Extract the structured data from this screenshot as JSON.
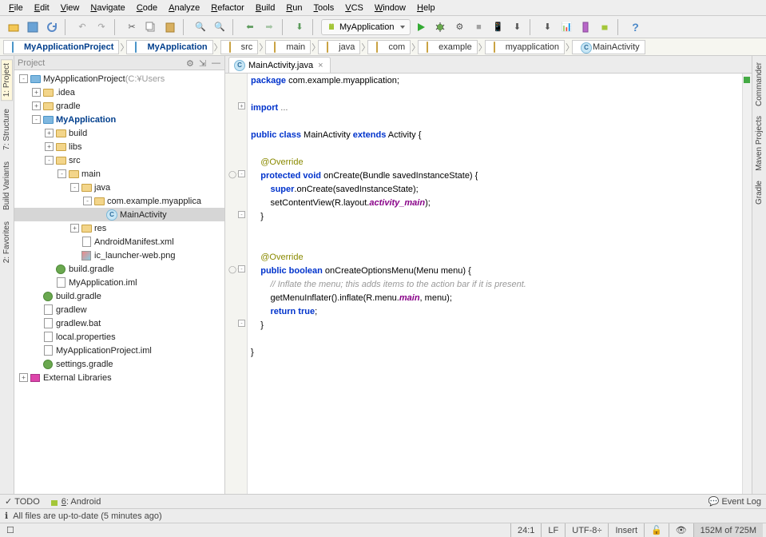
{
  "menu": [
    "File",
    "Edit",
    "View",
    "Navigate",
    "Code",
    "Analyze",
    "Refactor",
    "Build",
    "Run",
    "Tools",
    "VCS",
    "Window",
    "Help"
  ],
  "run_config": {
    "label": "MyApplication"
  },
  "breadcrumb": {
    "items": [
      {
        "label": "MyApplicationProject",
        "icon": "folder-blue",
        "bold": true
      },
      {
        "label": "MyApplication",
        "icon": "folder-blue",
        "bold": true
      },
      {
        "label": "src",
        "icon": "folder",
        "bold": false
      },
      {
        "label": "main",
        "icon": "folder",
        "bold": false
      },
      {
        "label": "java",
        "icon": "folder",
        "bold": false
      },
      {
        "label": "com",
        "icon": "folder",
        "bold": false
      },
      {
        "label": "example",
        "icon": "folder",
        "bold": false
      },
      {
        "label": "myapplication",
        "icon": "folder",
        "bold": false
      },
      {
        "label": "MainActivity",
        "icon": "class",
        "bold": false
      }
    ]
  },
  "sidebars": {
    "left": [
      {
        "label": "1: Project",
        "icon": "project"
      },
      {
        "label": "7: Structure",
        "icon": "structure"
      },
      {
        "label": "Build Variants",
        "icon": "build"
      },
      {
        "label": "2: Favorites",
        "icon": "fav"
      }
    ],
    "right": [
      {
        "label": "Commander",
        "icon": "commander"
      },
      {
        "label": "Maven Projects",
        "icon": "maven"
      },
      {
        "label": "Gradle",
        "icon": "gradle"
      }
    ]
  },
  "project_panel": {
    "title": "Project"
  },
  "tree": [
    {
      "d": 0,
      "t": "-",
      "i": "folder-blue",
      "l": "MyApplicationProject",
      "dim": "(C:¥Users"
    },
    {
      "d": 1,
      "t": "+",
      "i": "folder",
      "l": ".idea"
    },
    {
      "d": 1,
      "t": "+",
      "i": "folder",
      "l": "gradle"
    },
    {
      "d": 1,
      "t": "-",
      "i": "folder-blue",
      "l": "MyApplication",
      "bold": true
    },
    {
      "d": 2,
      "t": "+",
      "i": "folder",
      "l": "build"
    },
    {
      "d": 2,
      "t": "+",
      "i": "folder",
      "l": "libs"
    },
    {
      "d": 2,
      "t": "-",
      "i": "folder",
      "l": "src"
    },
    {
      "d": 3,
      "t": "-",
      "i": "folder",
      "l": "main"
    },
    {
      "d": 4,
      "t": "-",
      "i": "folder",
      "l": "java"
    },
    {
      "d": 5,
      "t": "-",
      "i": "pkg",
      "l": "com.example.myapplica"
    },
    {
      "d": 6,
      "t": "",
      "i": "class",
      "l": "MainActivity",
      "sel": true
    },
    {
      "d": 4,
      "t": "+",
      "i": "folder",
      "l": "res"
    },
    {
      "d": 4,
      "t": "",
      "i": "file",
      "l": "AndroidManifest.xml"
    },
    {
      "d": 4,
      "t": "",
      "i": "img",
      "l": "ic_launcher-web.png"
    },
    {
      "d": 2,
      "t": "",
      "i": "gradle",
      "l": "build.gradle"
    },
    {
      "d": 2,
      "t": "",
      "i": "file",
      "l": "MyApplication.iml"
    },
    {
      "d": 1,
      "t": "",
      "i": "gradle",
      "l": "build.gradle"
    },
    {
      "d": 1,
      "t": "",
      "i": "file",
      "l": "gradlew"
    },
    {
      "d": 1,
      "t": "",
      "i": "file",
      "l": "gradlew.bat"
    },
    {
      "d": 1,
      "t": "",
      "i": "file",
      "l": "local.properties"
    },
    {
      "d": 1,
      "t": "",
      "i": "file",
      "l": "MyApplicationProject.iml"
    },
    {
      "d": 1,
      "t": "",
      "i": "gradle",
      "l": "settings.gradle"
    },
    {
      "d": 0,
      "t": "+",
      "i": "lib",
      "l": "External Libraries"
    }
  ],
  "editor": {
    "tab_label": "MainActivity.java",
    "code_lines": [
      {
        "html": "<span class='kw'>package</span> com.example.myapplication<span>;</span>",
        "fold": ""
      },
      {
        "html": "",
        "fold": ""
      },
      {
        "html": "<span class='kw'>import</span> <span style='color:#666'>...</span>",
        "fold": "+"
      },
      {
        "html": "",
        "fold": ""
      },
      {
        "html": "<span class='kw'>public class</span> MainActivity <span class='kw'>extends</span> Activity {",
        "fold": ""
      },
      {
        "html": "",
        "fold": ""
      },
      {
        "html": "    <span class='ann'>@Override</span>",
        "fold": ""
      },
      {
        "html": "    <span class='kw'>protected void</span> onCreate(Bundle savedInstanceState) {",
        "fold": "o"
      },
      {
        "html": "        <span class='kw'>super</span>.onCreate(savedInstanceState);",
        "fold": ""
      },
      {
        "html": "        setContentView(R.layout.<span class='field'>activity_main</span>);",
        "fold": ""
      },
      {
        "html": "    }",
        "fold": "c"
      },
      {
        "html": "",
        "fold": ""
      },
      {
        "html": "",
        "fold": ""
      },
      {
        "html": "    <span class='ann'>@Override</span>",
        "fold": ""
      },
      {
        "html": "    <span class='kw'>public boolean</span> onCreateOptionsMenu(Menu menu) {",
        "fold": "o"
      },
      {
        "html": "        <span class='cmt'>// Inflate the menu; this adds items to the action bar if it is present.</span>",
        "fold": ""
      },
      {
        "html": "        getMenuInflater().inflate(R.menu.<span class='field'>main</span>, menu);",
        "fold": ""
      },
      {
        "html": "        <span class='kw'>return true</span>;",
        "fold": ""
      },
      {
        "html": "    }",
        "fold": "c"
      },
      {
        "html": "",
        "fold": ""
      },
      {
        "html": "}",
        "fold": ""
      },
      {
        "html": "",
        "fold": "",
        "hl": true
      }
    ]
  },
  "bottom": {
    "todo": "TODO",
    "android": "6: Android",
    "eventlog": "Event Log"
  },
  "status": {
    "msg": "All files are up-to-date (5 minutes ago)",
    "pos": "24:1",
    "eol": "LF",
    "enc": "UTF-8",
    "ins": "Insert",
    "mem": "152M of 725M"
  }
}
